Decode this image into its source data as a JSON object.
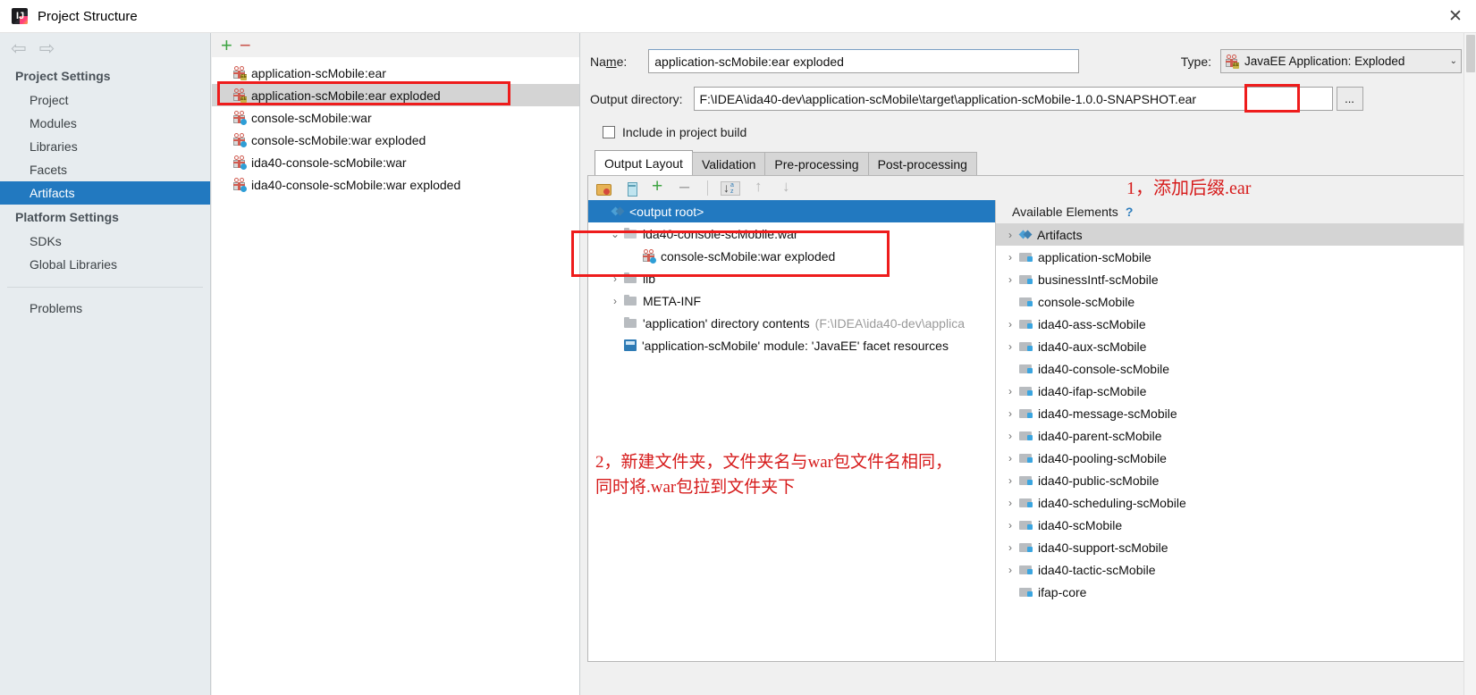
{
  "window": {
    "title": "Project Structure",
    "close_label": "✕",
    "app_icon": "intellij-idea-icon"
  },
  "sidebar": {
    "back_arrow": "⇦",
    "forward_arrow": "⇨",
    "groups": [
      {
        "label": "Project Settings",
        "items": [
          {
            "label": "Project",
            "selected": false
          },
          {
            "label": "Modules",
            "selected": false
          },
          {
            "label": "Libraries",
            "selected": false
          },
          {
            "label": "Facets",
            "selected": false
          },
          {
            "label": "Artifacts",
            "selected": true
          }
        ]
      },
      {
        "label": "Platform Settings",
        "items": [
          {
            "label": "SDKs",
            "selected": false
          },
          {
            "label": "Global Libraries",
            "selected": false
          }
        ]
      }
    ],
    "problems": "Problems"
  },
  "artifacts_panel": {
    "toolbar": {
      "add": "+",
      "remove": "−"
    },
    "items": [
      {
        "label": "application-scMobile:ear",
        "icon": "artifact-ear-icon",
        "selected": false,
        "highlight": false
      },
      {
        "label": "application-scMobile:ear exploded",
        "icon": "artifact-ear-icon",
        "selected": true,
        "highlight": true
      },
      {
        "label": "console-scMobile:war",
        "icon": "artifact-war-icon",
        "selected": false,
        "highlight": false
      },
      {
        "label": "console-scMobile:war exploded",
        "icon": "artifact-war-icon",
        "selected": false,
        "highlight": false
      },
      {
        "label": "ida40-console-scMobile:war",
        "icon": "artifact-war-icon",
        "selected": false,
        "highlight": false
      },
      {
        "label": "ida40-console-scMobile:war exploded",
        "icon": "artifact-war-icon",
        "selected": false,
        "highlight": false
      }
    ]
  },
  "detail": {
    "name_label": "Name:",
    "name_value": "application-scMobile:ear exploded",
    "type_label": "Type:",
    "type_value": "JavaEE Application: Exploded",
    "type_caret": "⌄",
    "output_label": "Output directory:",
    "output_value": "F:\\IDEA\\ida40-dev\\application-scMobile\\target\\application-scMobile-1.0.0-SNAPSHOT.ear",
    "browse_button": "...",
    "include_in_build_label": "Include in project build",
    "include_in_build_checked": false,
    "tabs": [
      {
        "label": "Output Layout",
        "active": true
      },
      {
        "label": "Validation",
        "active": false
      },
      {
        "label": "Pre-processing",
        "active": false
      },
      {
        "label": "Post-processing",
        "active": false
      }
    ],
    "layout_toolbar": [
      {
        "name": "create-directory-icon"
      },
      {
        "name": "create-archive-icon"
      },
      {
        "name": "add-icon"
      },
      {
        "name": "remove-icon"
      },
      {
        "name": "sort-icon"
      },
      {
        "name": "move-up-icon"
      },
      {
        "name": "move-down-icon"
      }
    ],
    "output_tree": [
      {
        "label": "<output root>",
        "icon": "artifacts-diamond-icon",
        "indent": 0,
        "twisty": "",
        "selected": true
      },
      {
        "label": "ida40-console-scMobile.war",
        "icon": "folder-icon",
        "indent": 1,
        "twisty": "⌄",
        "selected": false
      },
      {
        "label": "console-scMobile:war exploded",
        "icon": "artifact-war-icon",
        "indent": 2,
        "twisty": "",
        "selected": false
      },
      {
        "label": "lib",
        "icon": "folder-icon",
        "indent": 1,
        "twisty": "›",
        "selected": false
      },
      {
        "label": "META-INF",
        "icon": "folder-icon",
        "indent": 1,
        "twisty": "›",
        "selected": false
      },
      {
        "label": "'application' directory contents",
        "suffix": "(F:\\IDEA\\ida40-dev\\applica",
        "icon": "folder-icon",
        "indent": 1,
        "twisty": "",
        "selected": false
      },
      {
        "label": "'application-scMobile' module: 'JavaEE' facet resources",
        "icon": "facet-resources-icon",
        "indent": 1,
        "twisty": "",
        "selected": false
      }
    ],
    "available_header": "Available Elements",
    "available_help": "?",
    "available_tree": [
      {
        "label": "Artifacts",
        "icon": "artifacts-diamond-icon",
        "twisty": "›",
        "selected": true
      },
      {
        "label": "application-scMobile",
        "icon": "module-folder-icon",
        "twisty": "›",
        "selected": false
      },
      {
        "label": "businessIntf-scMobile",
        "icon": "module-folder-icon",
        "twisty": "›",
        "selected": false
      },
      {
        "label": "console-scMobile",
        "icon": "module-folder-icon",
        "twisty": "",
        "selected": false
      },
      {
        "label": "ida40-ass-scMobile",
        "icon": "module-folder-icon",
        "twisty": "›",
        "selected": false
      },
      {
        "label": "ida40-aux-scMobile",
        "icon": "module-folder-icon",
        "twisty": "›",
        "selected": false
      },
      {
        "label": "ida40-console-scMobile",
        "icon": "module-folder-icon",
        "twisty": "",
        "selected": false
      },
      {
        "label": "ida40-ifap-scMobile",
        "icon": "module-folder-icon",
        "twisty": "›",
        "selected": false
      },
      {
        "label": "ida40-message-scMobile",
        "icon": "module-folder-icon",
        "twisty": "›",
        "selected": false
      },
      {
        "label": "ida40-parent-scMobile",
        "icon": "module-folder-icon",
        "twisty": "›",
        "selected": false
      },
      {
        "label": "ida40-pooling-scMobile",
        "icon": "module-folder-icon",
        "twisty": "›",
        "selected": false
      },
      {
        "label": "ida40-public-scMobile",
        "icon": "module-folder-icon",
        "twisty": "›",
        "selected": false
      },
      {
        "label": "ida40-scheduling-scMobile",
        "icon": "module-folder-icon",
        "twisty": "›",
        "selected": false
      },
      {
        "label": "ida40-scMobile",
        "icon": "module-folder-icon",
        "twisty": "›",
        "selected": false
      },
      {
        "label": "ida40-support-scMobile",
        "icon": "module-folder-icon",
        "twisty": "›",
        "selected": false
      },
      {
        "label": "ida40-tactic-scMobile",
        "icon": "module-folder-icon",
        "twisty": "›",
        "selected": false
      },
      {
        "label": "ifap-core",
        "icon": "module-folder-icon",
        "twisty": "",
        "selected": false
      }
    ]
  },
  "annotations": {
    "color": "#d61b1b",
    "note1": "1，添加后缀.ear",
    "note2_line1": "2，新建文件夹，文件夹名与war包文件名相同，",
    "note2_line2": "同时将.war包拉到文件夹下"
  }
}
